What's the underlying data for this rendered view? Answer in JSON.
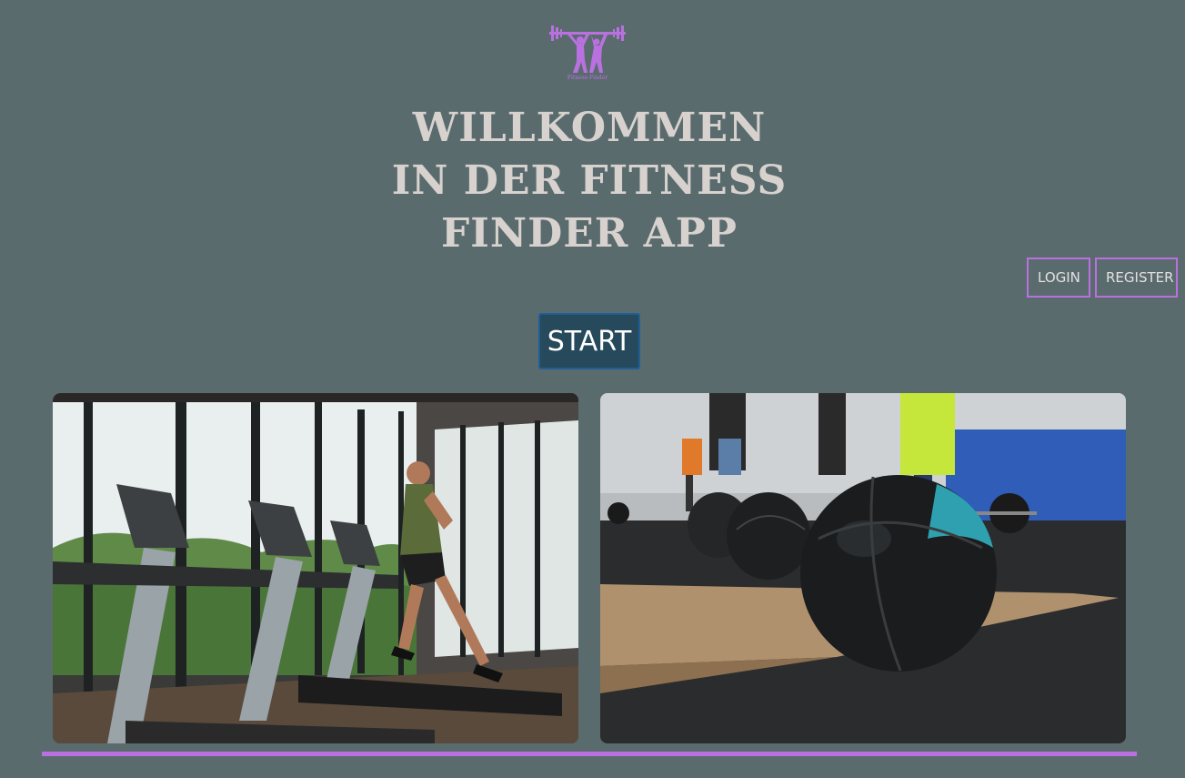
{
  "logo": {
    "icon": "weightlifter-logo-icon",
    "text": "Fitness-Finder",
    "color": "#b971e0"
  },
  "heading": {
    "line1": "WILLKOMMEN",
    "line2": "IN DER FITNESS",
    "line3": "FINDER APP"
  },
  "auth": {
    "login_label": "LOGIN",
    "register_label": "REGISTER"
  },
  "start": {
    "label": "START"
  },
  "photos": {
    "left": {
      "icon": "treadmill-gym-photo"
    },
    "right": {
      "icon": "medicine-balls-gym-photo"
    }
  },
  "colors": {
    "background": "#5a6b6e",
    "accent": "#b971e0",
    "start_button": "#264a5c",
    "title": "#d8d2cf"
  }
}
